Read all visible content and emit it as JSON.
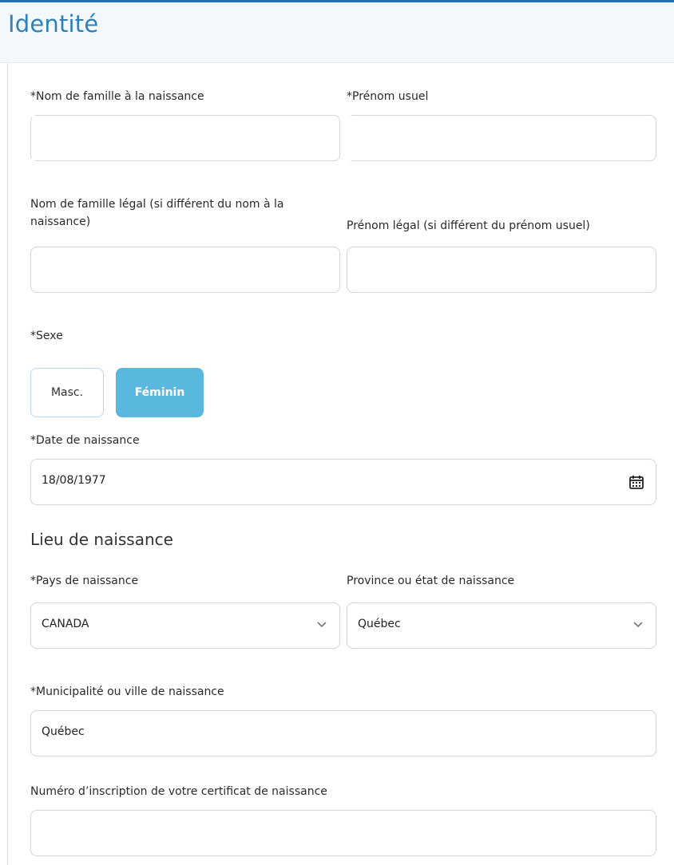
{
  "header": {
    "title": "Identité"
  },
  "fields": {
    "birth_last_name": {
      "label": "*Nom de famille à la naissance",
      "value": ""
    },
    "usual_first_name": {
      "label": "*Prénom usuel",
      "value": ""
    },
    "legal_last_name": {
      "label": "Nom de famille légal (si différent du nom à la naissance)",
      "value": ""
    },
    "legal_first_name": {
      "label": "Prénom légal (si différent du prénom usuel)",
      "value": ""
    },
    "sex": {
      "label": "*Sexe",
      "options": [
        "Masc.",
        "Féminin"
      ],
      "selected": "Féminin"
    },
    "birth_date": {
      "label": "*Date de naissance",
      "value": "18/08/1977"
    },
    "birth_place": {
      "section_title": "Lieu de naissance"
    },
    "birth_country": {
      "label": "*Pays de naissance",
      "value": "CANADA"
    },
    "birth_province": {
      "label": "Province ou état de naissance",
      "value": "Québec"
    },
    "birth_city": {
      "label": "*Municipalité ou ville de naissance",
      "value": "Québec"
    },
    "birth_certificate_number": {
      "label": "Numéro d’inscription de votre certificat de naissance",
      "value": ""
    }
  },
  "colors": {
    "header_title": "#2f7fb8",
    "selected_button": "#5ab8df"
  },
  "icons": {
    "date": "calendar-icon",
    "select": "chevron-down-icon"
  }
}
